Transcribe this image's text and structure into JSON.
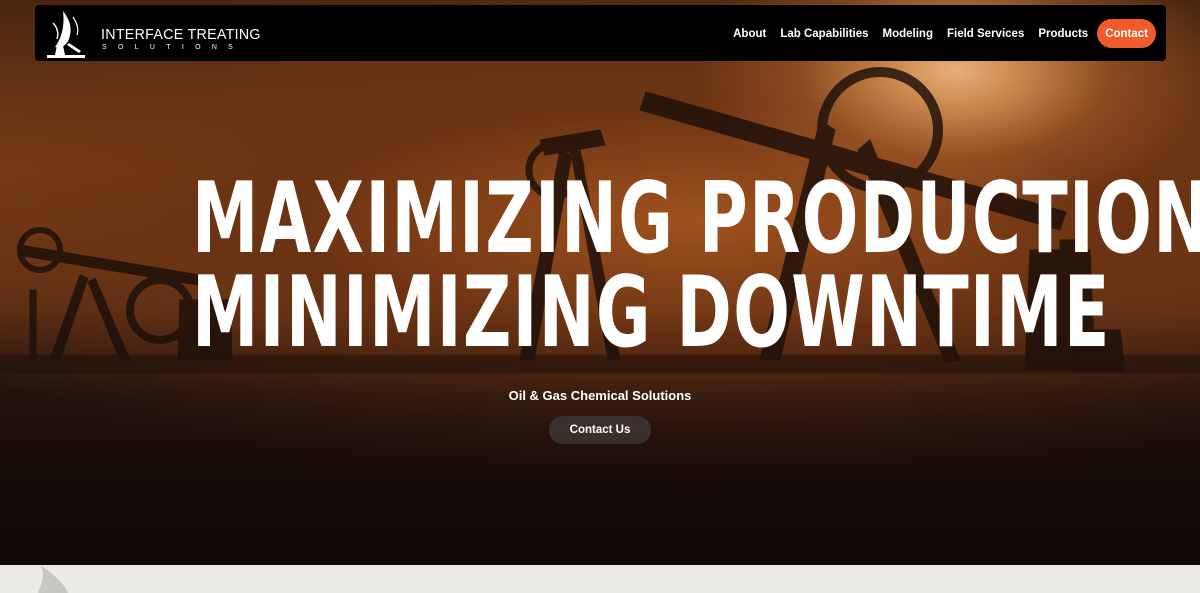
{
  "brand": {
    "name": "INTERFACE TREATING",
    "subname": "SOLUTIONS",
    "logo_icon": "feather-drop-logo-icon"
  },
  "nav": {
    "items": [
      {
        "label": "About"
      },
      {
        "label": "Lab Capabilities"
      },
      {
        "label": "Modeling"
      },
      {
        "label": "Field Services"
      },
      {
        "label": "Products"
      }
    ],
    "contact_label": "Contact"
  },
  "hero": {
    "headline_line1": "MAXIMIZING PRODUCTION,",
    "headline_line2": "MINIMIZING DOWNTIME",
    "subtitle": "Oil & Gas Chemical Solutions",
    "cta_label": "Contact Us",
    "background": "oil-pumpjacks-sunset-photo"
  },
  "colors": {
    "accent": "#f15a2b",
    "nav_bg": "#000000",
    "cta_bg": "#3c3432",
    "page_bg": "#ecebe6"
  }
}
